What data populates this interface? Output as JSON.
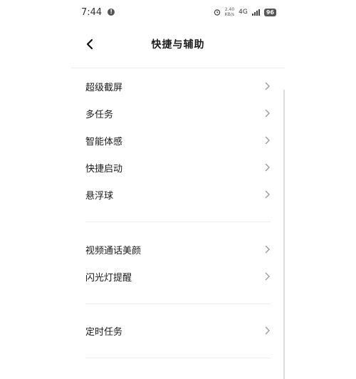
{
  "status_bar": {
    "time": "7:44",
    "notification_badge": "!",
    "net_speed_value": "2.40",
    "net_speed_unit": "KB/s",
    "network": "4G",
    "battery": "96"
  },
  "header": {
    "title": "快捷与辅助"
  },
  "groups": [
    {
      "items": [
        "超级截屏",
        "多任务",
        "智能体感",
        "快捷启动",
        "悬浮球"
      ]
    },
    {
      "items": [
        "视频通话美颜",
        "闪光灯提醒"
      ]
    },
    {
      "items": [
        "定时任务"
      ]
    }
  ],
  "colors": {
    "divider": "#ececec",
    "chevron": "#9a9a9a",
    "text": "#1a1a1a"
  }
}
